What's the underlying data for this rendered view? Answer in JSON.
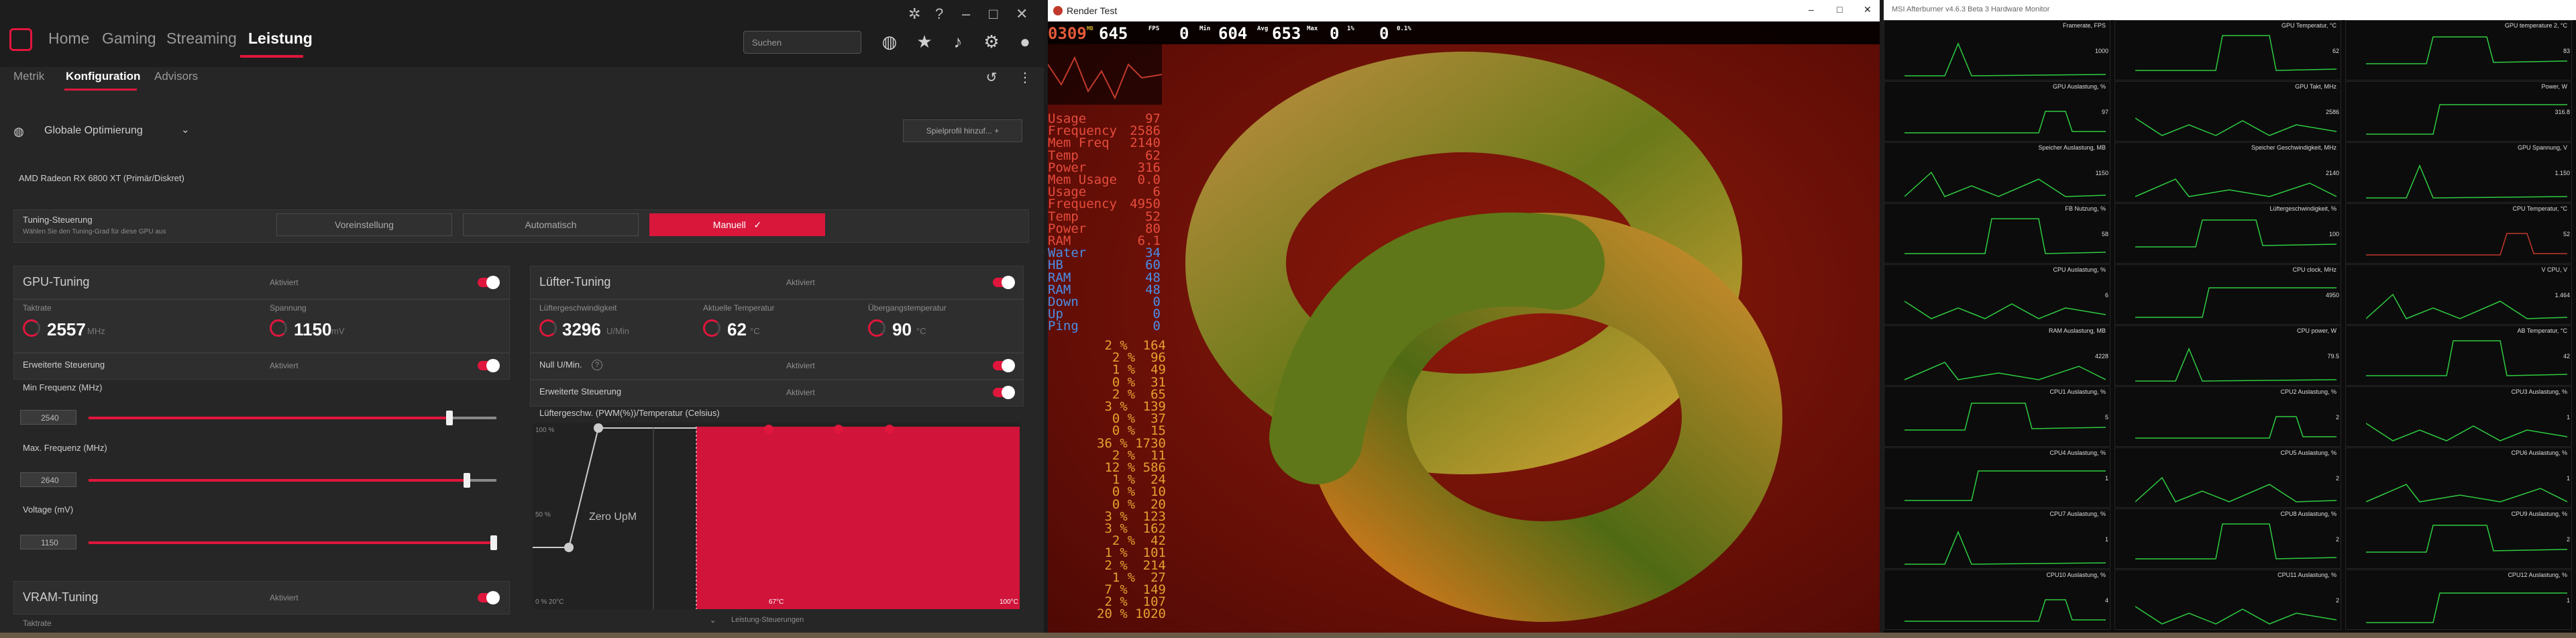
{
  "amd": {
    "nav": {
      "home": "Home",
      "gaming": "Gaming",
      "streaming": "Streaming",
      "leistung": "Leistung"
    },
    "search_placeholder": "Suchen",
    "subtabs": {
      "metrik": "Metrik",
      "konfiguration": "Konfiguration",
      "advisors": "Advisors"
    },
    "profile": {
      "label": "Globale Optimierung",
      "add_button": "Spielprofil hinzuf..."
    },
    "gpu_name": "AMD Radeon RX 6800 XT (Primär/Diskret)",
    "tuning": {
      "title": "Tuning-Steuerung",
      "subtitle": "Wählen Sie den Tuning-Grad für diese GPU aus",
      "btn_default": "Voreinstellung",
      "btn_auto": "Automatisch",
      "btn_manual": "Manuell"
    },
    "gpu_tuning": {
      "title": "GPU-Tuning",
      "state": "Aktiviert",
      "clock_label": "Taktrate",
      "clock_value": "2557",
      "clock_unit": "MHz",
      "voltage_label": "Spannung",
      "voltage_value": "1150",
      "voltage_unit": "mV",
      "advanced_label": "Erweiterte Steuerung",
      "advanced_state": "Aktiviert",
      "min_freq_label": "Min Frequenz (MHz)",
      "min_freq_value": "2540",
      "max_freq_label": "Max. Frequenz (MHz)",
      "max_freq_value": "2640",
      "volt_label": "Voltage (mV)",
      "volt_value": "1150"
    },
    "vram": {
      "title": "VRAM-Tuning",
      "state": "Aktiviert",
      "sub": "Taktrate"
    },
    "fan": {
      "title": "Lüfter-Tuning",
      "state": "Aktiviert",
      "speed_label": "Lüftergeschwindigkeit",
      "speed_value": "3296",
      "speed_unit": "U/Min",
      "temp_label": "Aktuelle Temperatur",
      "temp_value": "62",
      "temp_unit": "°C",
      "junction_label": "Übergangstemperatur",
      "junction_value": "90",
      "junction_unit": "°C",
      "zero_label": "Null U/Min.",
      "zero_state": "Aktiviert",
      "adv_label": "Erweiterte Steuerung",
      "adv_state": "Aktiviert",
      "curve_title": "Lüftergeschw. (PWM(%))/Temperatur (Celsius)",
      "curve_y_top": "100 %",
      "curve_y_mid": "50 %",
      "curve_origin": "0 % 20°C",
      "curve_zero": "Zero UpM",
      "curve_x_mid": "67°C",
      "curve_x_max": "100°C",
      "footer": "Leistung-Steuerungen"
    }
  },
  "render": {
    "title": "Render Test",
    "osd_head": {
      "a": "0309",
      "a_unit": "MB",
      "b": "645",
      "c": "FPS",
      "d": "0",
      "e": "Min",
      "f": "604",
      "g": "Avg",
      "h": "653",
      "i": "Max",
      "j": "0",
      "k": "1%",
      "l": "0",
      "m": "0.1%"
    },
    "left_labels": [
      "Usage",
      "Frequency",
      "Mem Freq",
      "Temp",
      "Power",
      "Mem Usage",
      "Usage",
      "Frequency",
      "Temp",
      "Power",
      "RAM",
      "Water",
      "HB",
      "RAM",
      "RAM",
      "Down",
      "Up",
      "Ping"
    ],
    "right_values": [
      "97",
      "2586",
      "2140",
      "62",
      "316",
      "0.0",
      "6",
      "4950",
      "52",
      "80",
      "6.1",
      "34",
      "60",
      "48",
      "48",
      "0",
      "0",
      "0"
    ],
    "core_rows": [
      "2 %  164",
      "2 %  96",
      "1 %  49",
      "0 %  31",
      "2 %  65",
      "3 %  139",
      "0 %  37",
      "0 %  15",
      "36 % 1730",
      "2 %  11",
      "12 % 586",
      "1 %  24",
      "0 %  10",
      "0 %  20",
      "3 %  123",
      "3 %  162",
      "2 %  42",
      "1 %  101",
      "2 %  214",
      "1 %  27",
      "7 %  149",
      "2 %  107",
      "20 % 1020"
    ]
  },
  "afterburner": {
    "title": "MSI Afterburner v4.6.3 Beta 3 Hardware Monitor",
    "graphs": [
      [
        "Framerate, FPS",
        "GPU Temperatur, °C",
        "GPU temperature 2, °C"
      ],
      [
        "GPU Auslastung, %",
        "GPU Takt, MHz",
        "Power, W"
      ],
      [
        "Speicher Auslastung, MB",
        "Speicher Geschwindigkeit, MHz",
        "GPU Spannung, V"
      ],
      [
        "FB Nutzung, %",
        "Lüftergeschwindigkeit, %",
        "CPU Temperatur, °C"
      ],
      [
        "CPU Auslastung, %",
        "CPU clock, MHz",
        "V CPU, V"
      ],
      [
        "RAM Auslastung, MB",
        "CPU power, W",
        "AB Temperatur, °C"
      ],
      [
        "CPU1 Auslastung, %",
        "CPU2 Auslastung, %",
        "CPU3 Auslastung, %"
      ],
      [
        "CPU4 Auslastung, %",
        "CPU5 Auslastung, %",
        "CPU6 Auslastung, %"
      ],
      [
        "CPU7 Auslastung, %",
        "CPU8 Auslastung, %",
        "CPU9 Auslastung, %"
      ],
      [
        "CPU10 Auslastung, %",
        "CPU11 Auslastung, %",
        "CPU12 Auslastung, %"
      ]
    ],
    "values": [
      [
        "1000",
        "62",
        "83"
      ],
      [
        "97",
        "2586",
        "316.8"
      ],
      [
        "1150",
        "2140",
        "1.150"
      ],
      [
        "58",
        "100",
        "52"
      ],
      [
        "6",
        "4950",
        "1.464"
      ],
      [
        "4228",
        "79.5",
        "42"
      ],
      [
        "5",
        "2",
        "1"
      ],
      [
        "1",
        "2",
        "1"
      ],
      [
        "1",
        "2",
        "2"
      ],
      [
        "4",
        "2",
        "1"
      ]
    ]
  }
}
